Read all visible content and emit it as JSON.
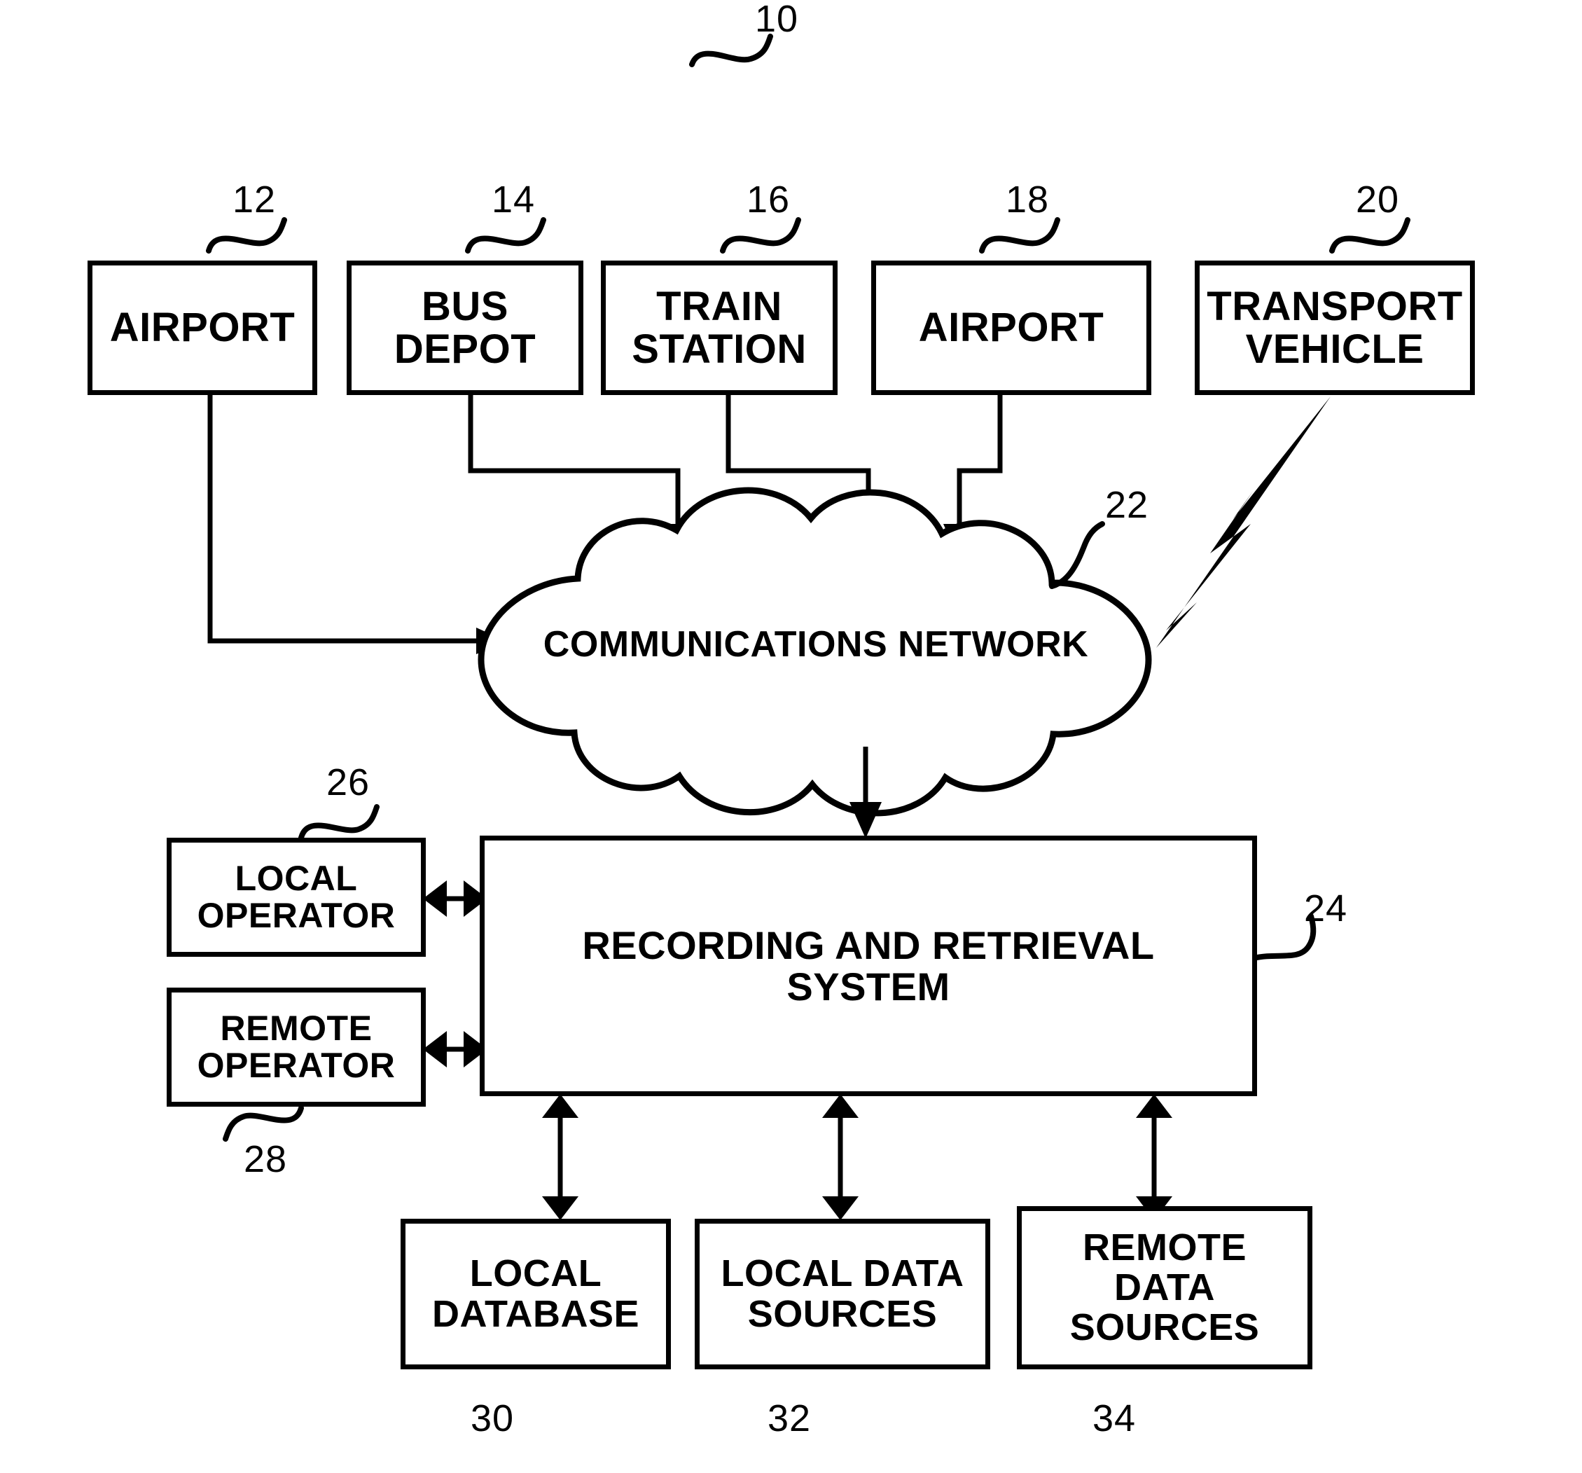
{
  "figure": {
    "figure_ref": "10",
    "nodes": [
      {
        "id": "airport1",
        "label": "AIRPORT",
        "ref": "12"
      },
      {
        "id": "busdepot",
        "label": "BUS\nDEPOT",
        "ref": "14"
      },
      {
        "id": "train",
        "label": "TRAIN\nSTATION",
        "ref": "16"
      },
      {
        "id": "airport2",
        "label": "AIRPORT",
        "ref": "18"
      },
      {
        "id": "vehicle",
        "label": "TRANSPORT\nVEHICLE",
        "ref": "20"
      },
      {
        "id": "network",
        "label": "COMMUNICATIONS NETWORK",
        "ref": "22"
      },
      {
        "id": "system",
        "label": "RECORDING AND RETRIEVAL\nSYSTEM",
        "ref": "24"
      },
      {
        "id": "localop",
        "label": "LOCAL\nOPERATOR",
        "ref": "26"
      },
      {
        "id": "remoteop",
        "label": "REMOTE\nOPERATOR",
        "ref": "28"
      },
      {
        "id": "localdb",
        "label": "LOCAL\nDATABASE",
        "ref": "30"
      },
      {
        "id": "localdata",
        "label": "LOCAL DATA\nSOURCES",
        "ref": "32"
      },
      {
        "id": "remotedata",
        "label": "REMOTE\nDATA\nSOURCES",
        "ref": "34"
      }
    ],
    "colors": {
      "stroke": "#000000",
      "background": "#ffffff"
    }
  }
}
